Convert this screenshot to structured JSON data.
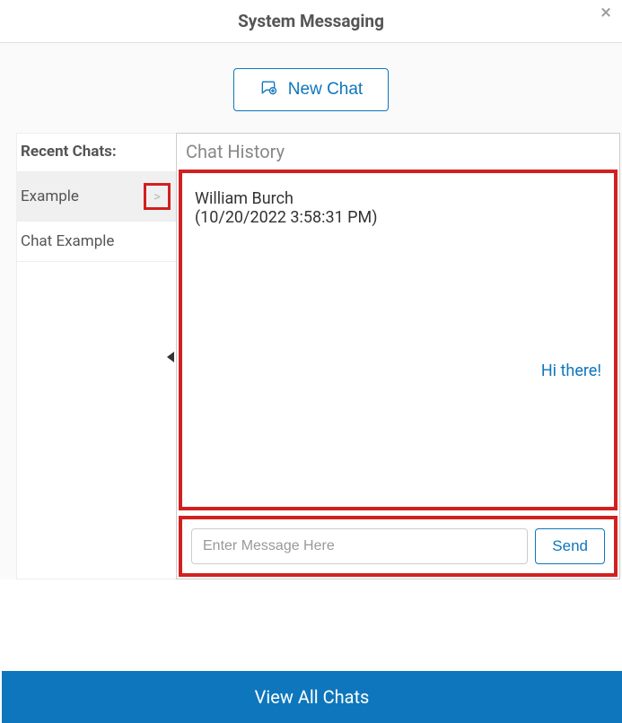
{
  "header": {
    "title": "System Messaging",
    "close_label": "×"
  },
  "new_chat": {
    "label": "New Chat"
  },
  "sidebar": {
    "title": "Recent Chats:",
    "items": [
      {
        "label": "Example",
        "active": true
      },
      {
        "label": "Chat Example",
        "active": false
      }
    ],
    "chevron": ">"
  },
  "chat": {
    "title": "Chat History",
    "author": "William Burch",
    "timestamp": "(10/20/2022 3:58:31 PM)",
    "message": "Hi there!",
    "input_placeholder": "Enter Message Here",
    "send_label": "Send"
  },
  "footer": {
    "view_all": "View All Chats"
  }
}
